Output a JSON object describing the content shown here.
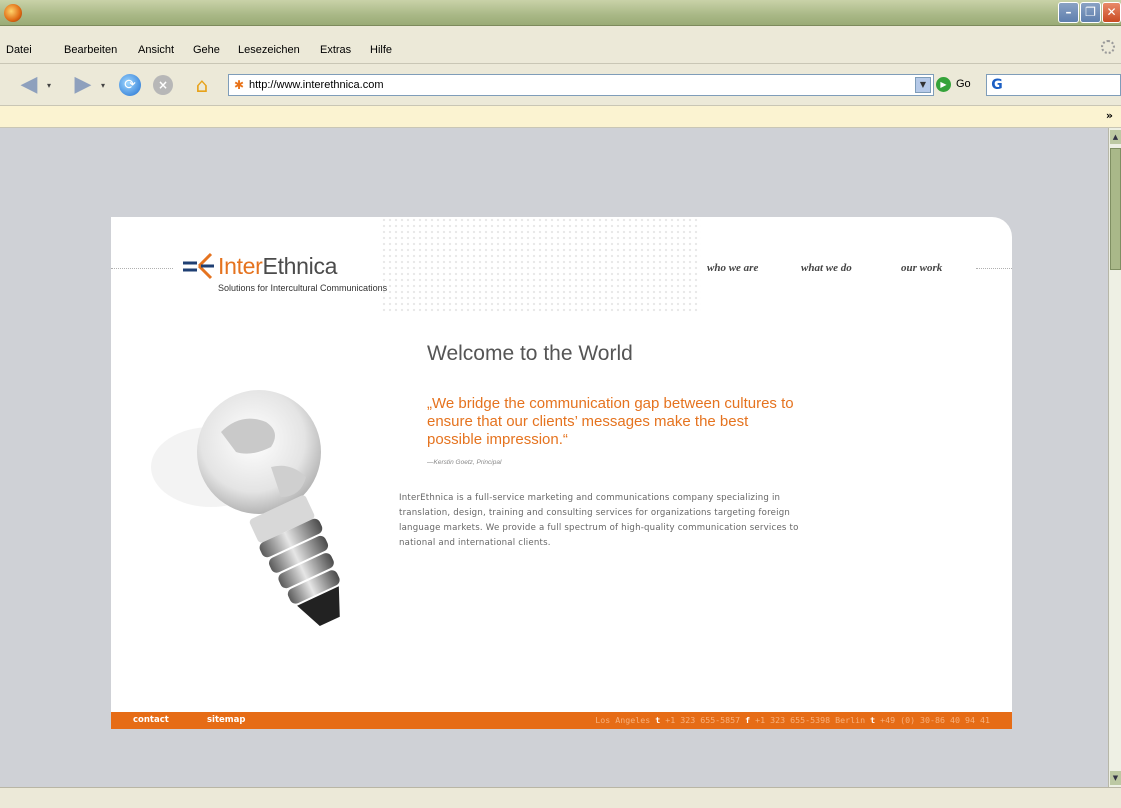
{
  "browser": {
    "menu": [
      "Datei",
      "Bearbeiten",
      "Ansicht",
      "Gehe",
      "Lesezeichen",
      "Extras",
      "Hilfe"
    ],
    "url": "http://www.interethnica.com",
    "go_label": "Go",
    "bookmarks_chevron": "»"
  },
  "site": {
    "logo": {
      "inter": "Inter",
      "ethnica": "Ethnica"
    },
    "tagline": "Solutions for Intercultural Communications",
    "nav": [
      "who we are",
      "what we do",
      "our work"
    ],
    "heading": "Welcome to the World",
    "quote": "„We bridge the communication gap between cultures to ensure that our clients’ messages make the best possible impression.“",
    "quote_author": "—Kerstin Goetz, Principal",
    "body": "InterEthnica is a full-service marketing and communications company specializing in translation, design, training and consulting services for organizations targeting foreign language markets. We provide a full spectrum of high-quality communication services to national and international clients.",
    "footer": {
      "links": [
        "contact",
        "sitemap"
      ],
      "la_city": "Los Angeles",
      "la_t_label": "t",
      "la_t": "+1 323 655-5857",
      "la_f_label": "f",
      "la_f": "+1 323 655-5398",
      "berlin_city": "Berlin",
      "berlin_t_label": "t",
      "berlin_t": "+49 (0) 30-86 40 94 41"
    }
  },
  "colors": {
    "accent": "#e5731f",
    "footer_bg": "#e66c16",
    "viewport_bg": "#cfd1d6"
  }
}
